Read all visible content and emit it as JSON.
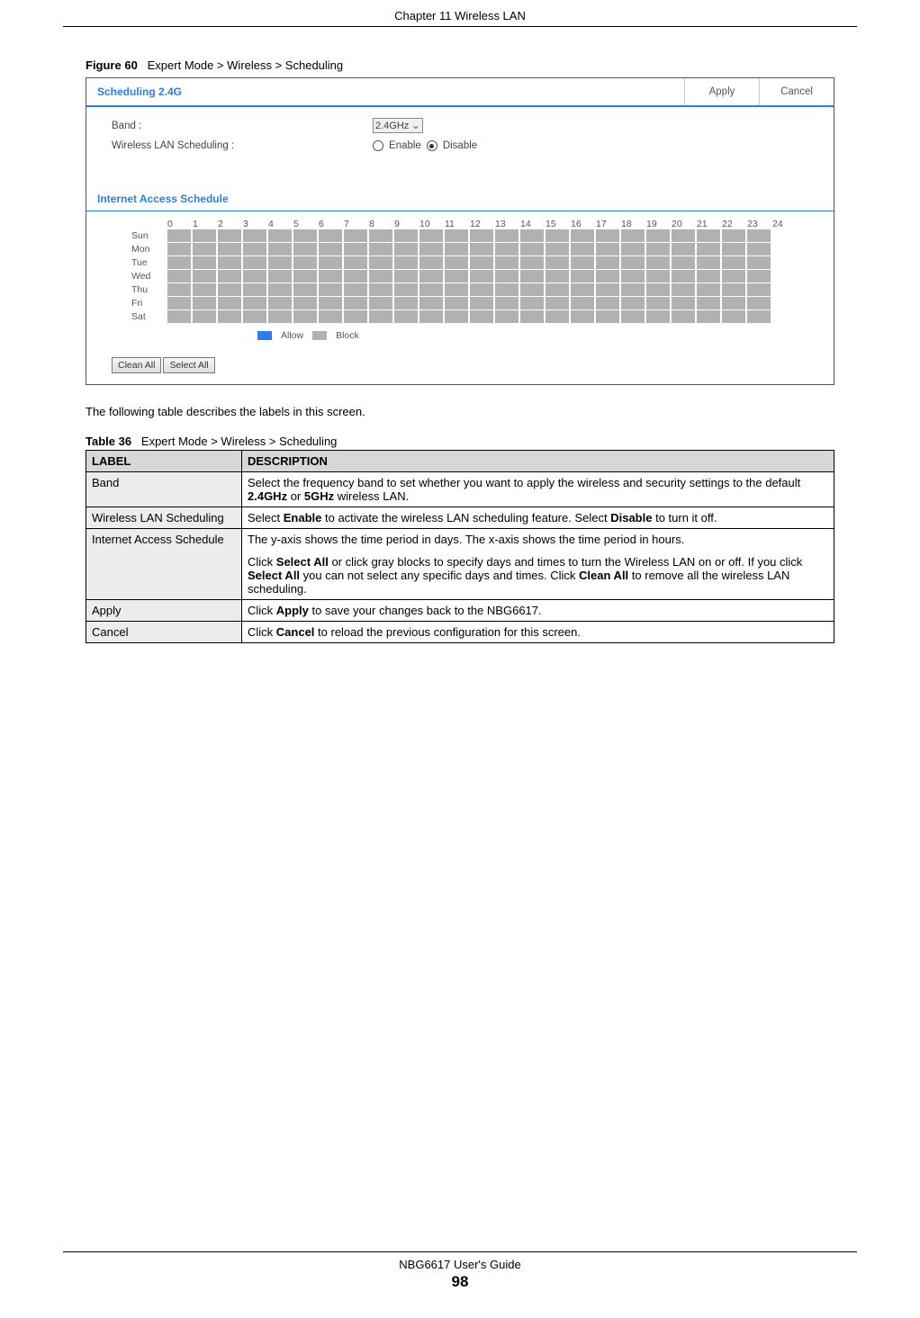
{
  "header": {
    "chapter": "Chapter 11 Wireless LAN"
  },
  "figure": {
    "label": "Figure 60",
    "caption": "Expert Mode > Wireless > Scheduling"
  },
  "screenshot": {
    "title": "Scheduling 2.4G",
    "apply": "Apply",
    "cancel": "Cancel",
    "band_label": "Band :",
    "band_value": "2.4GHz",
    "sched_label": "Wireless LAN Scheduling :",
    "enable": "Enable",
    "disable": "Disable",
    "section": "Internet Access Schedule",
    "hours": [
      "0",
      "1",
      "2",
      "3",
      "4",
      "5",
      "6",
      "7",
      "8",
      "9",
      "10",
      "11",
      "12",
      "13",
      "14",
      "15",
      "16",
      "17",
      "18",
      "19",
      "20",
      "21",
      "22",
      "23",
      "24"
    ],
    "days": [
      "Sun",
      "Mon",
      "Tue",
      "Wed",
      "Thu",
      "Fri",
      "Sat"
    ],
    "legend_allow": "Allow",
    "legend_block": "Block",
    "clean_all": "Clean All",
    "select_all": "Select All"
  },
  "intro": "The following table describes the labels in this screen.",
  "table": {
    "label": "Table 36",
    "caption": "Expert Mode > Wireless > Scheduling",
    "headers": {
      "label": "LABEL",
      "desc": "DESCRIPTION"
    },
    "rows": [
      {
        "label": "Band",
        "desc_pre": "Select the frequency band to set whether you want to apply the wireless and security settings to the default ",
        "b1": "2.4GHz",
        "mid": " or ",
        "b2": "5GHz",
        "desc_post": " wireless LAN."
      },
      {
        "label": "Wireless LAN Scheduling",
        "desc_pre": "Select ",
        "b1": "Enable",
        "mid": " to activate the wireless LAN scheduling feature. Select ",
        "b2": "Disable",
        "desc_post": " to turn it off."
      },
      {
        "label": "Internet Access Schedule",
        "p1": "The y-axis shows the time period in days. The x-axis shows the time period in hours.",
        "p2_pre": "Click ",
        "p2_b1": "Select All",
        "p2_mid1": " or click gray blocks to specify days and times to turn the Wireless LAN on or off. If you click ",
        "p2_b2": "Select All",
        "p2_mid2": " you can not select any specific days and times. Click ",
        "p2_b3": "Clean All",
        "p2_post": " to remove all the wireless LAN scheduling."
      },
      {
        "label": "Apply",
        "desc_pre": "Click ",
        "b1": "Apply",
        "desc_post": " to save your changes back to the NBG6617."
      },
      {
        "label": "Cancel",
        "desc_pre": "Click ",
        "b1": "Cancel",
        "desc_post": " to reload the previous configuration for this screen."
      }
    ]
  },
  "footer": {
    "guide": "NBG6617 User's Guide",
    "page": "98"
  }
}
